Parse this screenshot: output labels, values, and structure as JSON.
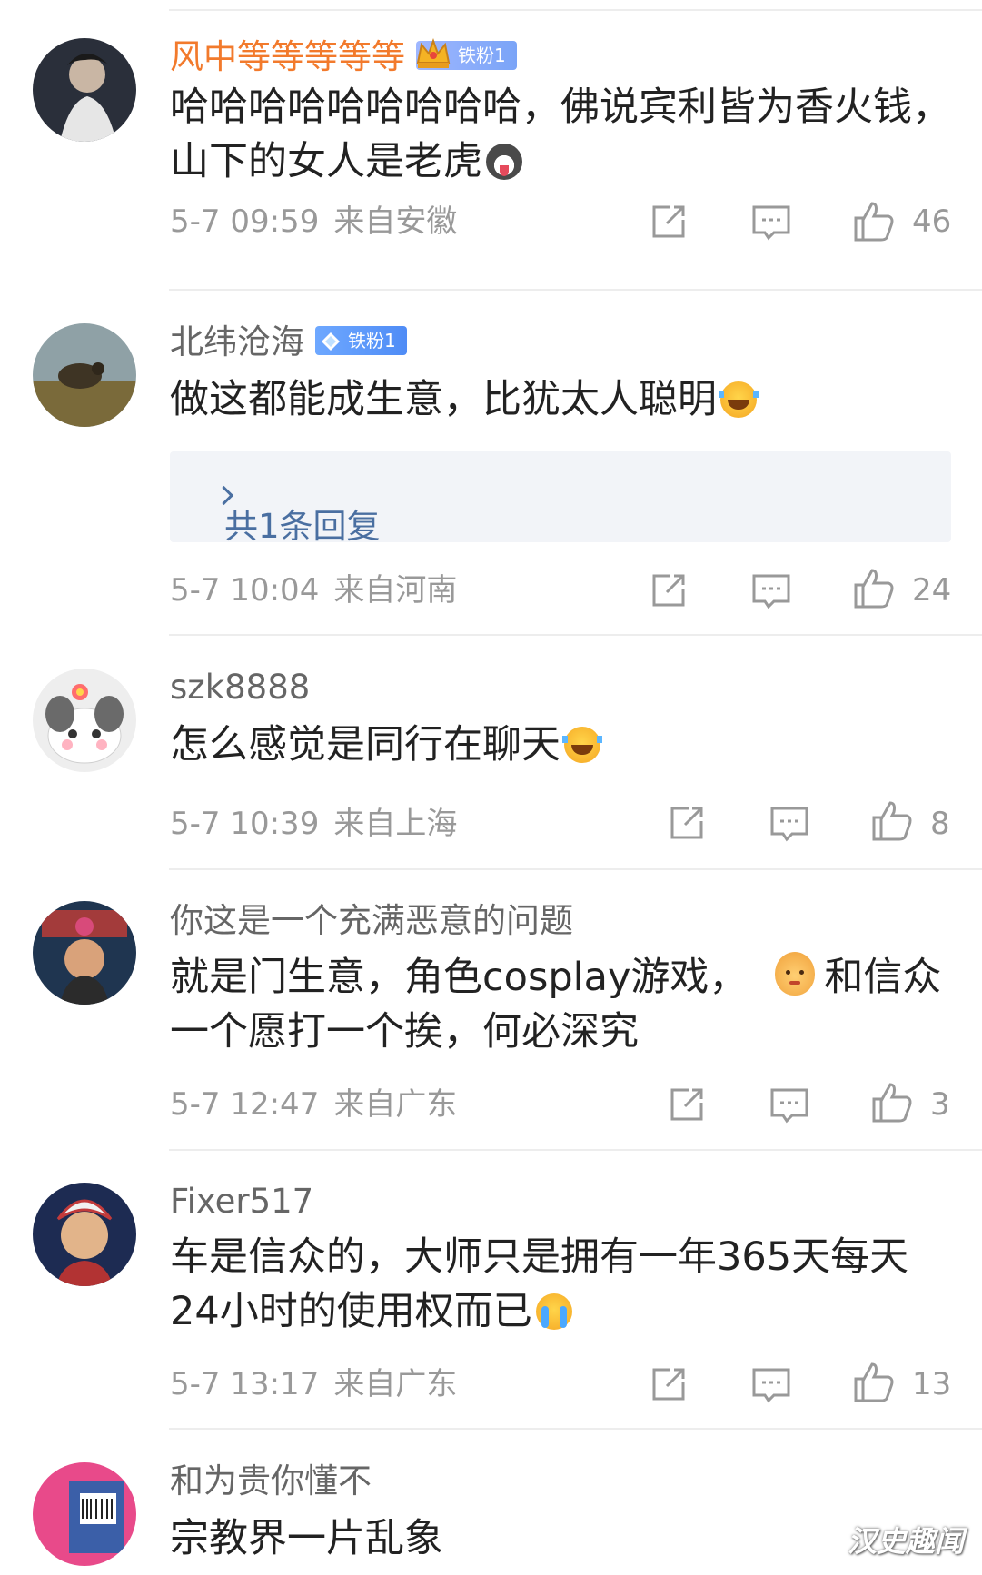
{
  "comments": [
    {
      "username": "风中等等等等等",
      "badge": "铁粉1",
      "text": "哈哈哈哈哈哈哈哈哈，佛说宾利皆为香火钱，山下的女人是老虎",
      "emoji": "husky-emoji",
      "date": "5-7 09:59",
      "location": "来自安徽",
      "likes": "46"
    },
    {
      "username": "北纬沧海",
      "badge": "铁粉1",
      "text": "做这都能成生意，比犹太人聪明",
      "emoji": "laugh-cry-emoji",
      "replies": "共1条回复",
      "date": "5-7 10:04",
      "location": "来自河南",
      "likes": "24"
    },
    {
      "username": "szk8888",
      "text": "怎么感觉是同行在聊天",
      "emoji": "laugh-cry-emoji",
      "date": "5-7 10:39",
      "location": "来自上海",
      "likes": "8"
    },
    {
      "username": "你这是一个充满恶意的问题",
      "text_before": "就是门生意，角色cosplay游戏，",
      "text_after": "和信众一个愿打一个挨，何必深究",
      "emoji": "baby-face-emoji",
      "date": "5-7 12:47",
      "location": "来自广东",
      "likes": "3"
    },
    {
      "username": "Fixer517",
      "text": "车是信众的，大师只是拥有一年365天每天24小时的使用权而已",
      "emoji": "crying-emoji",
      "date": "5-7 13:17",
      "location": "来自广东",
      "likes": "13"
    },
    {
      "username": "和为贵你懂不",
      "text": "宗教界一片乱象"
    }
  ],
  "watermark": "汉史趣闻",
  "colors": {
    "vip_name": "#f27a2c",
    "name": "#666666",
    "text": "#222222",
    "meta": "#999999",
    "reply_link": "#4a6fa1",
    "reply_bg": "#f2f4f8"
  },
  "icons": [
    "share-icon",
    "comment-icon",
    "like-icon",
    "chevron-right-icon",
    "crown-icon",
    "diamond-icon"
  ]
}
